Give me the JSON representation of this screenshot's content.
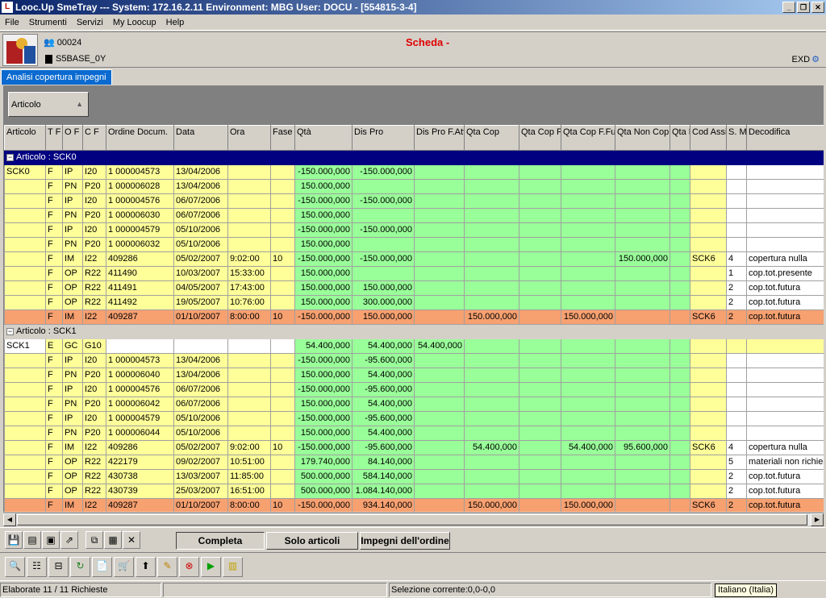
{
  "window": {
    "title": "Looc.Up SmeTray --- System: 172.16.2.11 Environment: MBG User: DOCU - [554815-3-4]",
    "app_icon": "L"
  },
  "menu": [
    "File",
    "Strumenti",
    "Servizi",
    "My Loocup",
    "Help"
  ],
  "header": {
    "line1": "00024",
    "line2": "S5BASE_0Y",
    "title": "Scheda -",
    "right": "EXD"
  },
  "tab": "Analisi copertura impegni",
  "group_chip": "Articolo",
  "columns": [
    "Articolo",
    "T F",
    "O F",
    "C F",
    "Ordine Docum.",
    "Data",
    "Ora",
    "Fase",
    "Qtà",
    "Dis Pro",
    "Dis Pro F.Att",
    "Qta Cop",
    "Qta Cop F.Att",
    "Qta Cop F.Fut",
    "Qta Non Cop",
    "Qta Neu",
    "Cod Assieme",
    "S. Mat",
    "Decodifica"
  ],
  "groups": [
    {
      "label": "Articolo : SCK0",
      "selected": true,
      "rows": [
        [
          "SCK0",
          "F",
          "IP",
          "I20",
          "1     000004573",
          "13/04/2006",
          "",
          "",
          "-150.000,000",
          "-150.000,000",
          "",
          "",
          "",
          "",
          "",
          "",
          "",
          "",
          ""
        ],
        [
          "",
          "F",
          "PN",
          "P20",
          "1     000006028",
          "13/04/2006",
          "",
          "",
          "150.000,000",
          "",
          "",
          "",
          "",
          "",
          "",
          "",
          "",
          "",
          ""
        ],
        [
          "",
          "F",
          "IP",
          "I20",
          "1     000004576",
          "06/07/2006",
          "",
          "",
          "-150.000,000",
          "-150.000,000",
          "",
          "",
          "",
          "",
          "",
          "",
          "",
          "",
          ""
        ],
        [
          "",
          "F",
          "PN",
          "P20",
          "1     000006030",
          "06/07/2006",
          "",
          "",
          "150.000,000",
          "",
          "",
          "",
          "",
          "",
          "",
          "",
          "",
          "",
          ""
        ],
        [
          "",
          "F",
          "IP",
          "I20",
          "1     000004579",
          "05/10/2006",
          "",
          "",
          "-150.000,000",
          "-150.000,000",
          "",
          "",
          "",
          "",
          "",
          "",
          "",
          "",
          ""
        ],
        [
          "",
          "F",
          "PN",
          "P20",
          "1     000006032",
          "05/10/2006",
          "",
          "",
          "150.000,000",
          "",
          "",
          "",
          "",
          "",
          "",
          "",
          "",
          "",
          ""
        ],
        [
          "",
          "F",
          "IM",
          "I22",
          "409286",
          "05/02/2007",
          "9:02:00",
          "10",
          "-150.000,000",
          "-150.000,000",
          "",
          "",
          "",
          "",
          "150.000,000",
          "",
          "SCK6",
          "4",
          "copertura nulla"
        ],
        [
          "",
          "F",
          "OP",
          "R22",
          "411490",
          "10/03/2007",
          "15:33:00",
          "",
          "150.000,000",
          "",
          "",
          "",
          "",
          "",
          "",
          "",
          "",
          "1",
          "cop.tot.presente"
        ],
        [
          "",
          "F",
          "OP",
          "R22",
          "411491",
          "04/05/2007",
          "17:43:00",
          "",
          "150.000,000",
          "150.000,000",
          "",
          "",
          "",
          "",
          "",
          "",
          "",
          "2",
          "cop.tot.futura"
        ],
        [
          "",
          "F",
          "OP",
          "R22",
          "411492",
          "19/05/2007",
          "10:76:00",
          "",
          "150.000,000",
          "300.000,000",
          "",
          "",
          "",
          "",
          "",
          "",
          "",
          "2",
          "cop.tot.futura"
        ],
        [
          "",
          "F",
          "IM",
          "I22",
          "409287",
          "01/10/2007",
          "8:00:00",
          "10",
          "-150.000,000",
          "150.000,000",
          "",
          "150.000,000",
          "",
          "150.000,000",
          "",
          "",
          "SCK6",
          "2",
          "cop.tot.futura"
        ]
      ]
    },
    {
      "label": "Articolo : SCK1",
      "selected": false,
      "rows": [
        [
          "SCK1",
          "E",
          "GC",
          "G10",
          "",
          "",
          "",
          "",
          "54.400,000",
          "54.400,000",
          "54.400,000",
          "",
          "",
          "",
          "",
          "",
          "",
          "",
          ""
        ],
        [
          "",
          "F",
          "IP",
          "I20",
          "1     000004573",
          "13/04/2006",
          "",
          "",
          "-150.000,000",
          "-95.600,000",
          "",
          "",
          "",
          "",
          "",
          "",
          "",
          "",
          ""
        ],
        [
          "",
          "F",
          "PN",
          "P20",
          "1     000006040",
          "13/04/2006",
          "",
          "",
          "150.000,000",
          "54.400,000",
          "",
          "",
          "",
          "",
          "",
          "",
          "",
          "",
          ""
        ],
        [
          "",
          "F",
          "IP",
          "I20",
          "1     000004576",
          "06/07/2006",
          "",
          "",
          "-150.000,000",
          "-95.600,000",
          "",
          "",
          "",
          "",
          "",
          "",
          "",
          "",
          ""
        ],
        [
          "",
          "F",
          "PN",
          "P20",
          "1     000006042",
          "06/07/2006",
          "",
          "",
          "150.000,000",
          "54.400,000",
          "",
          "",
          "",
          "",
          "",
          "",
          "",
          "",
          ""
        ],
        [
          "",
          "F",
          "IP",
          "I20",
          "1     000004579",
          "05/10/2006",
          "",
          "",
          "-150.000,000",
          "-95.600,000",
          "",
          "",
          "",
          "",
          "",
          "",
          "",
          "",
          ""
        ],
        [
          "",
          "F",
          "PN",
          "P20",
          "1     000006044",
          "05/10/2006",
          "",
          "",
          "150.000,000",
          "54.400,000",
          "",
          "",
          "",
          "",
          "",
          "",
          "",
          "",
          ""
        ],
        [
          "",
          "F",
          "IM",
          "I22",
          "409286",
          "05/02/2007",
          "9:02:00",
          "10",
          "-150.000,000",
          "-95.600,000",
          "",
          "54.400,000",
          "",
          "54.400,000",
          "95.600,000",
          "",
          "SCK6",
          "4",
          "copertura nulla"
        ],
        [
          "",
          "F",
          "OP",
          "R22",
          "422179",
          "09/02/2007",
          "10:51:00",
          "",
          "179.740,000",
          "84.140,000",
          "",
          "",
          "",
          "",
          "",
          "",
          "",
          "5",
          "materiali non richiesti"
        ],
        [
          "",
          "F",
          "OP",
          "R22",
          "430738",
          "13/03/2007",
          "11:85:00",
          "",
          "500.000,000",
          "584.140,000",
          "",
          "",
          "",
          "",
          "",
          "",
          "",
          "2",
          "cop.tot.futura"
        ],
        [
          "",
          "F",
          "OP",
          "R22",
          "430739",
          "25/03/2007",
          "16:51:00",
          "",
          "500.000,000",
          "1.084.140,000",
          "",
          "",
          "",
          "",
          "",
          "",
          "",
          "2",
          "cop.tot.futura"
        ],
        [
          "",
          "F",
          "IM",
          "I22",
          "409287",
          "01/10/2007",
          "8:00:00",
          "10",
          "-150.000,000",
          "934.140,000",
          "",
          "150.000,000",
          "",
          "150.000,000",
          "",
          "",
          "SCK6",
          "2",
          "cop.tot.futura"
        ]
      ]
    }
  ],
  "view_tabs": [
    "Completa",
    "Solo articoli",
    "Impegni dell'ordine"
  ],
  "status": {
    "left": "Elaborate 11 / 11 Richieste",
    "selection": "Selezione corrente:0,0-0,0",
    "tooltip": "Italiano (Italia)"
  }
}
